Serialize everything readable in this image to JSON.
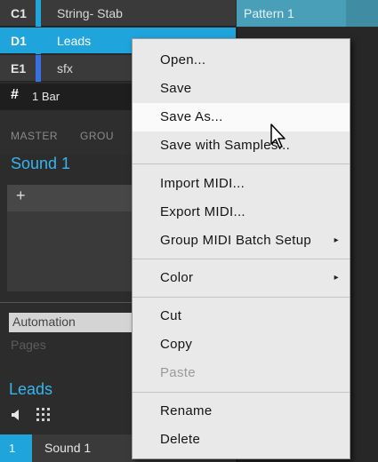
{
  "groups": [
    {
      "id": "C1",
      "name": "String- Stab",
      "color": "#1fa4dc"
    },
    {
      "id": "D1",
      "name": "Leads",
      "color": "#1fa4dc"
    },
    {
      "id": "E1",
      "name": "sfx",
      "color": "#3a6fe0"
    }
  ],
  "pattern": {
    "name": "Pattern 1"
  },
  "bar": {
    "hash": "#",
    "label": "1 Bar"
  },
  "tabs": {
    "master": "MASTER",
    "group": "GROU"
  },
  "sound_title": "Sound 1",
  "plus": "+",
  "automation": {
    "label": "Automation",
    "pages": "Pages"
  },
  "group_title": "Leads",
  "sound_row": {
    "index": "1",
    "name": "Sound 1"
  },
  "menu": {
    "items": [
      {
        "label": "Open..."
      },
      {
        "label": "Save"
      },
      {
        "label": "Save As..."
      },
      {
        "label": "Save with Samples..."
      },
      {
        "label": "Import MIDI..."
      },
      {
        "label": "Export MIDI..."
      },
      {
        "label": "Group MIDI Batch Setup"
      },
      {
        "label": "Color"
      },
      {
        "label": "Cut"
      },
      {
        "label": "Copy"
      },
      {
        "label": "Paste"
      },
      {
        "label": "Rename"
      },
      {
        "label": "Delete"
      }
    ],
    "submenu_arrow": "▸",
    "highlighted": "Save As...",
    "disabled": [
      "Paste"
    ]
  },
  "colors": {
    "accent": "#1fa4dc",
    "title_blue": "#36b5ee",
    "menu_bg": "#e9e9e9"
  }
}
